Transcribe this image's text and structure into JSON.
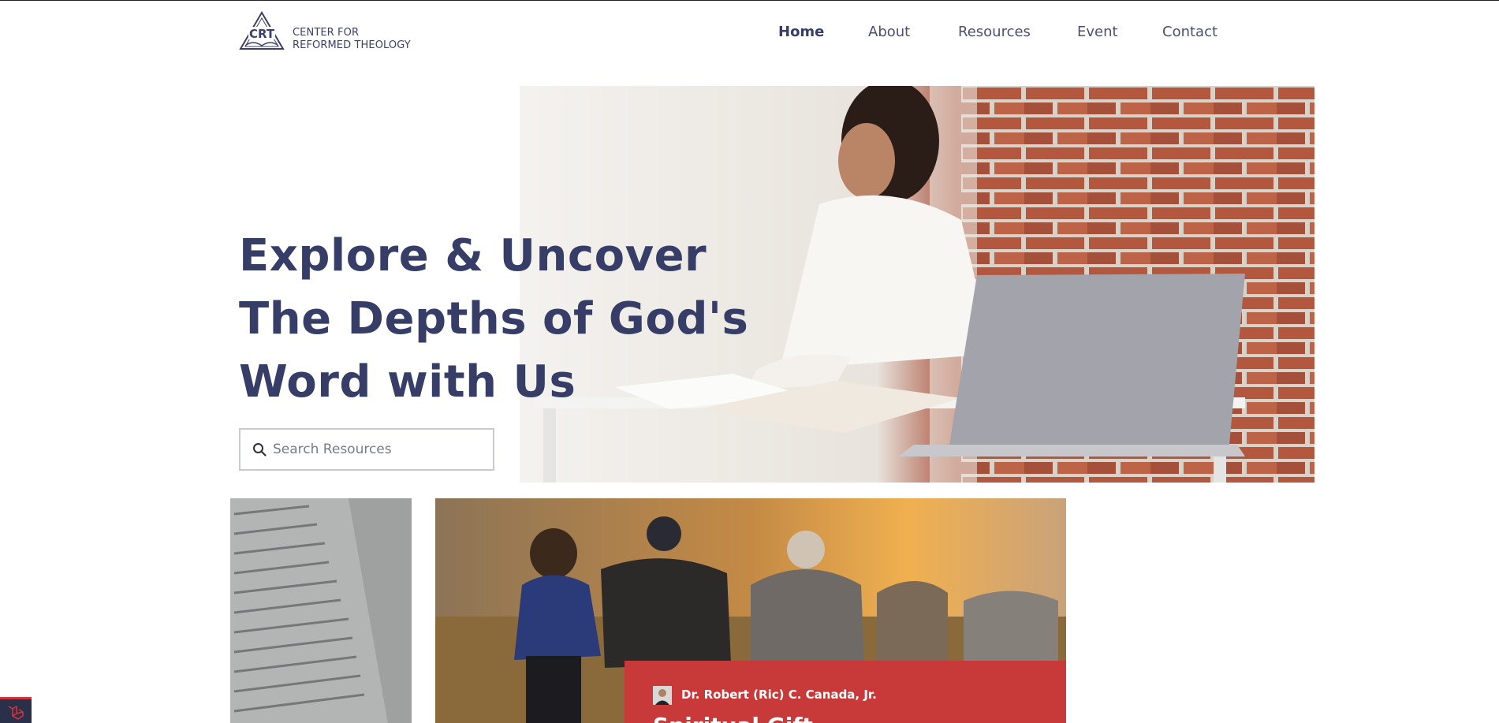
{
  "logo": {
    "mark": "CRT",
    "line1": "CENTER FOR",
    "line2": "REFORMED THEOLOGY"
  },
  "nav": {
    "items": [
      {
        "label": "Home",
        "active": true
      },
      {
        "label": "About",
        "active": false
      },
      {
        "label": "Resources",
        "active": false
      },
      {
        "label": "Event",
        "active": false
      },
      {
        "label": "Contact",
        "active": false
      }
    ]
  },
  "hero": {
    "title_lines": [
      "Explore & Uncover",
      "The Depths of God's",
      "Word with Us"
    ],
    "image_icon": "woman-reading-at-desk-photo"
  },
  "search": {
    "placeholder": "Search Resources",
    "value": "",
    "icon": "search-icon"
  },
  "cards": {
    "book": {
      "image_icon": "open-book-photo"
    },
    "event": {
      "image_icon": "friends-running-sunset-photo",
      "author": "Dr. Robert (Ric) C. Canada, Jr.",
      "title_partial": "Spiritual Gift"
    }
  },
  "colors": {
    "brand_navy": "#363d66",
    "event_red": "#c8393a",
    "nav_text": "#4a5070"
  }
}
